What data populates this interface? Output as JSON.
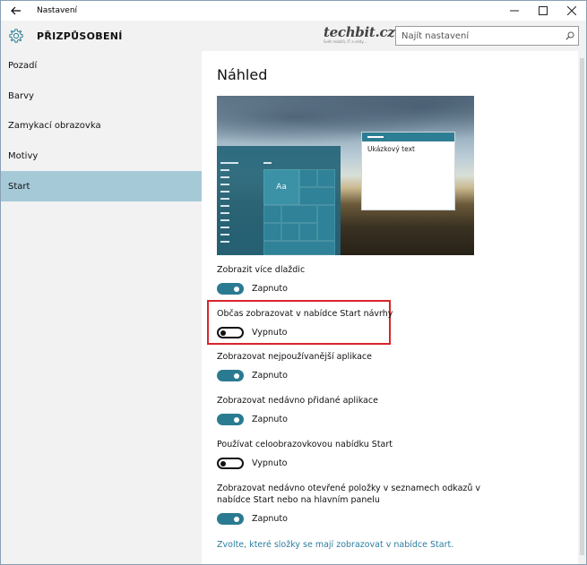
{
  "window": {
    "title": "Nastavení",
    "back_icon": "back-arrow-icon",
    "controls": [
      "minimize-icon",
      "maximize-icon",
      "close-icon"
    ]
  },
  "header": {
    "icon": "gear-icon",
    "title": "PŘIZPŮSOBENÍ",
    "brand": {
      "name": "techbit.cz",
      "tagline": "Svět mobilů, IT a vědy..."
    },
    "search": {
      "placeholder": "Najít nastavení",
      "icon": "search-icon"
    }
  },
  "sidebar": {
    "items": [
      {
        "label": "Pozadí",
        "active": false
      },
      {
        "label": "Barvy",
        "active": false
      },
      {
        "label": "Zamykací obrazovka",
        "active": false
      },
      {
        "label": "Motivy",
        "active": false
      },
      {
        "label": "Start",
        "active": true
      }
    ]
  },
  "main": {
    "preview_title": "Náhled",
    "preview": {
      "tile_label": "Aa",
      "sample_text": "Ukázkový text"
    },
    "settings": [
      {
        "label": "Zobrazit více dlaždic",
        "state": "Zapnuto",
        "on": true
      },
      {
        "label": "Občas zobrazovat v nabídce Start návrhy",
        "state": "Vypnuto",
        "on": false,
        "highlighted": true
      },
      {
        "label": "Zobrazovat nejpoužívanější aplikace",
        "state": "Zapnuto",
        "on": true
      },
      {
        "label": "Zobrazovat nedávno přidané aplikace",
        "state": "Zapnuto",
        "on": true
      },
      {
        "label": "Používat celoobrazovkovou nabídku Start",
        "state": "Vypnuto",
        "on": false
      },
      {
        "label_line1": "Zobrazovat nedávno otevřené položky v seznamech odkazů v",
        "label_line2": "nabídce Start nebo na hlavním panelu",
        "state": "Zapnuto",
        "on": true
      }
    ],
    "link": "Zvolte, které složky se mají zobrazovat v nabídce Start."
  },
  "colors": {
    "accent": "#2a7b91",
    "sidebar_active": "#a6c9d8",
    "highlight": "#d8252b",
    "link": "#2c7ea0"
  }
}
